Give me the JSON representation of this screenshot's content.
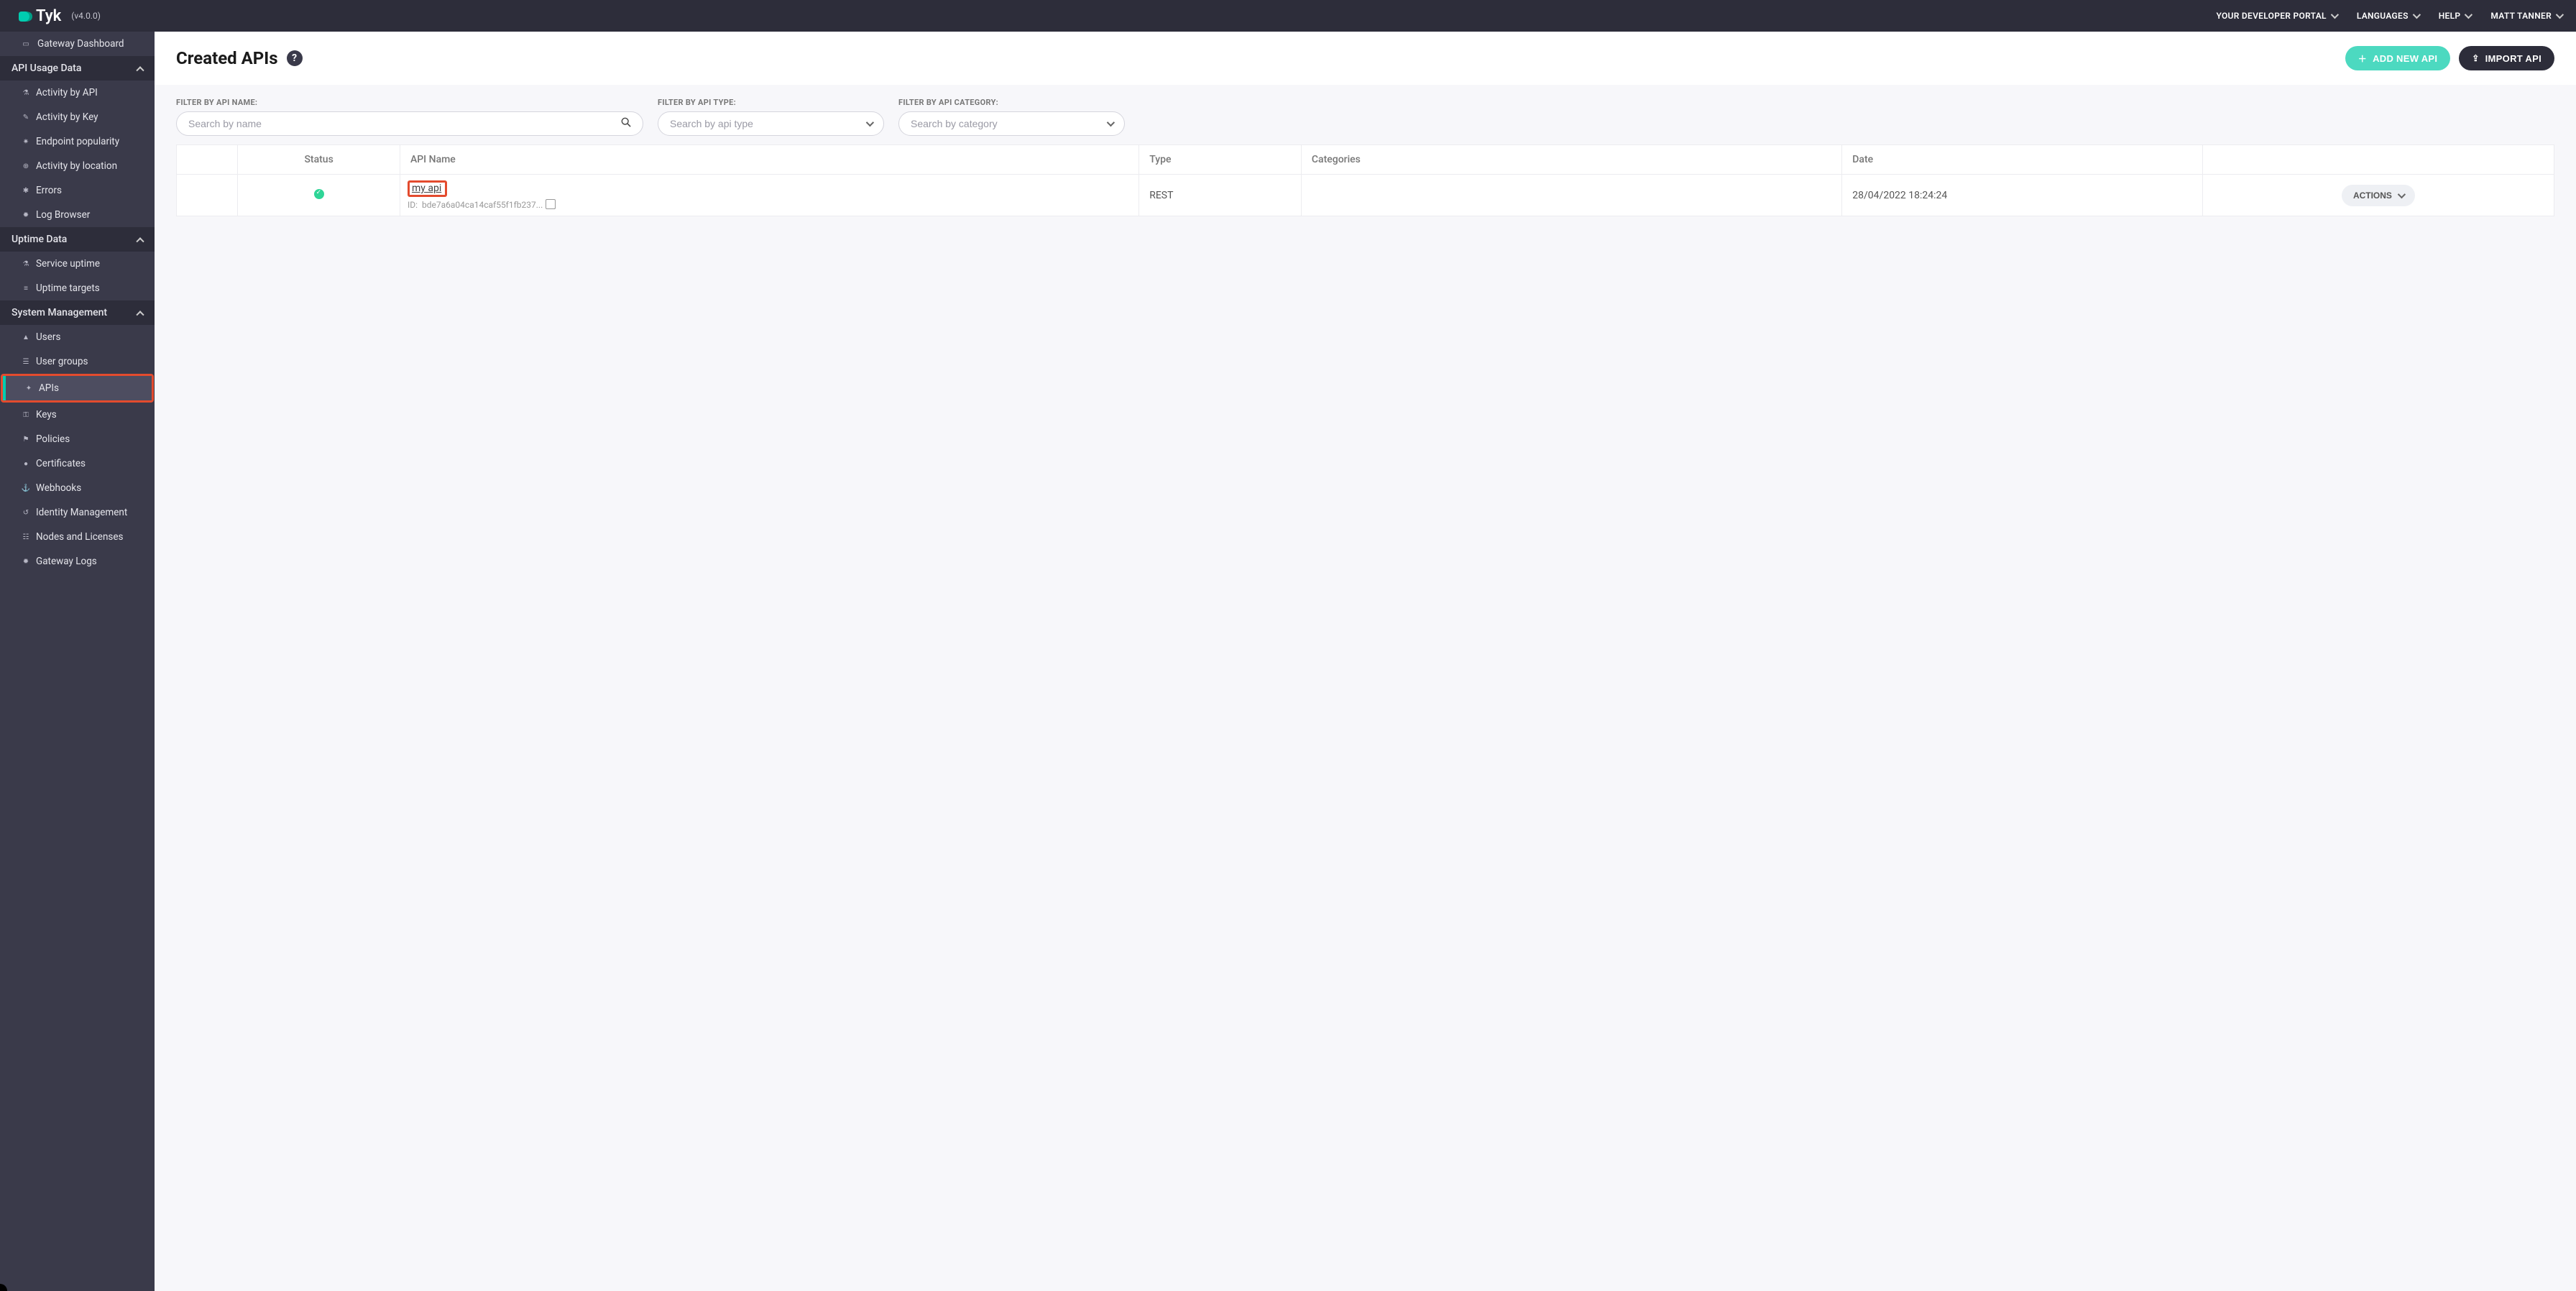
{
  "topbar": {
    "brand": "Tyk",
    "version": "(v4.0.0)",
    "links": {
      "portal": "YOUR DEVELOPER PORTAL",
      "languages": "LANGUAGES",
      "help": "HELP",
      "user": "MATT TANNER"
    }
  },
  "sidebar": {
    "dashboard": "Gateway Dashboard",
    "groups": {
      "usage": {
        "label": "API Usage Data",
        "items": {
          "activity_api": "Activity by API",
          "activity_key": "Activity by Key",
          "endpoint_pop": "Endpoint popularity",
          "activity_loc": "Activity by location",
          "errors": "Errors",
          "log_browser": "Log Browser"
        }
      },
      "uptime": {
        "label": "Uptime Data",
        "items": {
          "service_uptime": "Service uptime",
          "uptime_targets": "Uptime targets"
        }
      },
      "system": {
        "label": "System Management",
        "items": {
          "users": "Users",
          "user_groups": "User groups",
          "apis": "APIs",
          "keys": "Keys",
          "policies": "Policies",
          "certificates": "Certificates",
          "webhooks": "Webhooks",
          "identity_mgmt": "Identity Management",
          "nodes": "Nodes and Licenses",
          "gateway_logs": "Gateway Logs"
        }
      }
    }
  },
  "page": {
    "title": "Created APIs",
    "add_btn": "ADD NEW API",
    "import_btn": "IMPORT API"
  },
  "filters": {
    "name_label": "FILTER BY API NAME:",
    "name_placeholder": "Search by name",
    "type_label": "FILTER BY API TYPE:",
    "type_placeholder": "Search by api type",
    "cat_label": "FILTER BY API CATEGORY:",
    "cat_placeholder": "Search by category"
  },
  "table": {
    "headers": {
      "status": "Status",
      "name": "API Name",
      "type": "Type",
      "categories": "Categories",
      "date": "Date"
    },
    "rows": [
      {
        "name": "my api",
        "id_prefix": "ID: ",
        "id": "bde7a6a04ca14caf55f1fb237...",
        "type": "REST",
        "categories": "",
        "date": "28/04/2022 18:24:24",
        "actions_label": "ACTIONS"
      }
    ]
  }
}
